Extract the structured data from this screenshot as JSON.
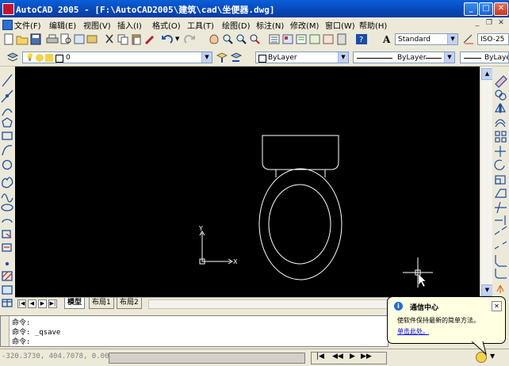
{
  "window": {
    "title": "AutoCAD 2005 - [F:\\AutoCAD2005\\建筑\\cad\\坐便器.dwg]",
    "min_glyph": "_",
    "max_glyph": "□",
    "close_glyph": "✕",
    "mdi_glyphs": [
      "_",
      "❐",
      "✕"
    ]
  },
  "menubar": {
    "items": [
      "文件(F)",
      "编辑(E)",
      "视图(V)",
      "插入(I)",
      "格式(O)",
      "工具(T)",
      "绘图(D)",
      "标注(N)",
      "修改(M)",
      "窗口(W)",
      "帮助(H)"
    ]
  },
  "toolbar": {
    "text_style": "Standard",
    "dim_style": "ISO-25",
    "layer": "0",
    "color": "ByLayer",
    "linetype": "ByLayer",
    "lineweight": "ByLayer"
  },
  "drawing": {
    "ucs_x": "X",
    "ucs_y": "Y"
  },
  "layout_tabs": [
    "模型",
    "布局1",
    "布局2"
  ],
  "command": {
    "lines": [
      "命令:",
      "命令: _qsave",
      "命令:"
    ]
  },
  "status": {
    "coords": "-320.3730, 404.7078, 0.00"
  },
  "balloon": {
    "title": "通信中心",
    "body": "使软件保持最新的简单方法。",
    "link": "单击此处。",
    "close_glyph": "✕"
  },
  "colors": {
    "titlebar": "#0747b8",
    "canvas": "#000000",
    "drawing_lines": "#ffffff",
    "balloon_bg": "#ffffe1",
    "link": "#0000ff"
  }
}
